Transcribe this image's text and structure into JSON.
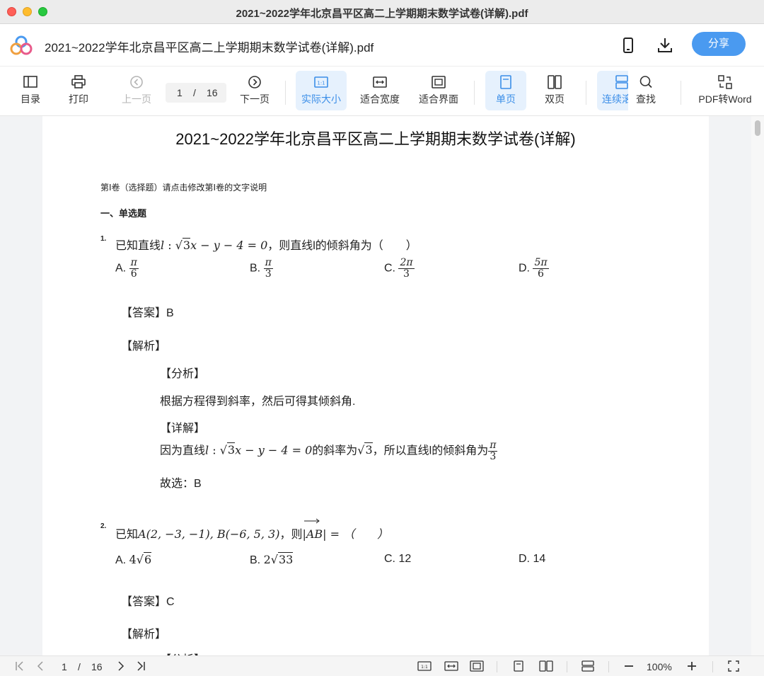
{
  "window": {
    "title": "2021~2022学年北京昌平区高二上学期期末数学试卷(详解).pdf"
  },
  "header": {
    "file_name": "2021~2022学年北京昌平区高二上学期期末数学试卷(详解).pdf",
    "share_label": "分享",
    "logo_icon": "app-cloud-logo-icon",
    "phone_icon": "phone-icon",
    "download_icon": "download-icon"
  },
  "toolbar": {
    "toc": "目录",
    "print": "打印",
    "prev": "上一页",
    "page_current": "1",
    "page_sep": "/",
    "page_total": "16",
    "next": "下一页",
    "actual_size": "实际大小",
    "fit_width": "适合宽度",
    "fit_page": "适合界面",
    "single_page": "单页",
    "double_page": "双页",
    "continuous": "连续滚",
    "find": "查找",
    "pdf_to_word": "PDF转Word"
  },
  "document": {
    "title": "2021~2022学年北京昌平区高二上学期期末数学试卷(详解)",
    "section_note": "第Ⅰ卷（选择题）请点击修改第Ⅰ卷的文字说明",
    "section_heading": "一、单选题",
    "q1": {
      "num": "1.",
      "stem_prefix": "已知直线",
      "stem_line": "l",
      "stem_colon": " : ",
      "stem_sqrt": "3",
      "stem_rest": "x − y − 4 = 0",
      "stem_suffix": "，则直线l的倾斜角为（　　）",
      "option_a_label": "A.",
      "option_a_num": "π",
      "option_a_den": "6",
      "option_b_label": "B.",
      "option_b_num": "π",
      "option_b_den": "3",
      "option_c_label": "C.",
      "option_c_num": "2π",
      "option_c_den": "3",
      "option_d_label": "D.",
      "option_d_num": "5π",
      "option_d_den": "6",
      "answer": "【答案】B",
      "analysis_heading": "【解析】",
      "analysis_sub": "【分析】",
      "analysis_text": "根据方程得到斜率，然后可得其倾斜角.",
      "detail_heading": "【详解】",
      "detail_prefix": "因为直线",
      "detail_line": "l",
      "detail_colon": " : ",
      "detail_sqrt": "3",
      "detail_rest": "x − y − 4 = 0",
      "detail_mid": "的斜率为",
      "detail_sqrt2": "3",
      "detail_suffix": "，所以直线l的倾斜角为",
      "detail_frac_num": "π",
      "detail_frac_den": "3",
      "choice": "故选：B"
    },
    "q2": {
      "num": "2.",
      "stem_prefix": "已知",
      "stem_math": "A(2, −3, −1), B(−6, 5, 3)",
      "stem_then": "，则",
      "stem_vec": "|AB| = （　　）",
      "option_a_label": "A.",
      "option_a_coef": "4",
      "option_a_sqrt": "6",
      "option_b_label": "B.",
      "option_b_coef": "2",
      "option_b_sqrt": "33",
      "option_c": "C. 12",
      "option_d": "D. 14",
      "answer": "【答案】C",
      "analysis_heading": "【解析】",
      "analysis_sub": "【分析】"
    }
  },
  "statusbar": {
    "page_current": "1",
    "page_sep": "/",
    "page_total": "16",
    "zoom": "100%"
  }
}
